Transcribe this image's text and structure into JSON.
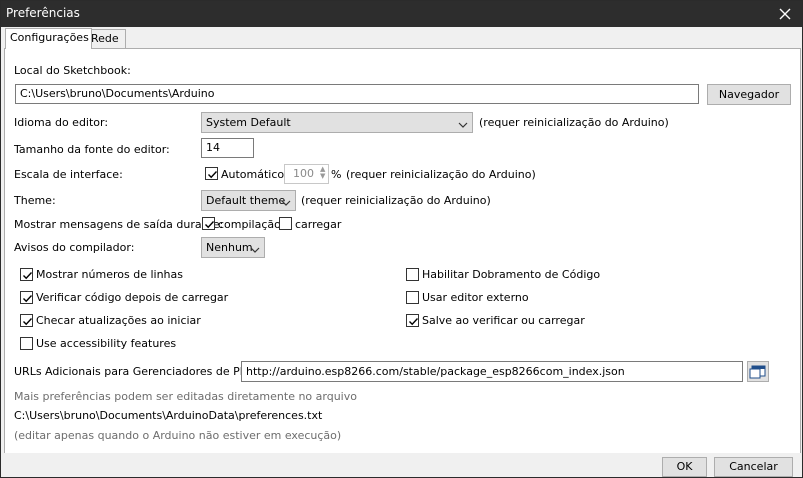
{
  "window": {
    "title": "Preferências"
  },
  "tabs": [
    {
      "label": "Configurações"
    },
    {
      "label": "Rede"
    }
  ],
  "sketchbook": {
    "label": "Local do Sketchbook:",
    "path": "C:\\Users\\bruno\\Documents\\Arduino",
    "browse_button": "Navegador"
  },
  "language": {
    "label": "Idioma do editor:",
    "value": "System Default",
    "note": "(requer reinicialização do Arduino)"
  },
  "font_size": {
    "label": "Tamanho da fonte do editor:",
    "value": "14"
  },
  "scale": {
    "label": "Escala de interface:",
    "auto_label": "Automático",
    "value": "100",
    "unit": "%",
    "note": "(requer reinicialização do Arduino)",
    "auto_checked": true
  },
  "theme": {
    "label": "Theme:",
    "value": "Default theme",
    "note": "(requer reinicialização do Arduino)"
  },
  "verbose": {
    "label": "Mostrar mensagens de saída durante:",
    "compile_label": "compilação",
    "compile_checked": true,
    "upload_label": "carregar",
    "upload_checked": false
  },
  "warnings": {
    "label": "Avisos do compilador:",
    "value": "Nenhum"
  },
  "options_left": [
    {
      "label": "Mostrar números de linhas",
      "checked": true
    },
    {
      "label": "Verificar código depois de carregar",
      "checked": true
    },
    {
      "label": "Checar atualizações ao iniciar",
      "checked": true
    },
    {
      "label": "Use accessibility features",
      "checked": false
    }
  ],
  "options_right": [
    {
      "label": "Habilitar Dobramento de Código",
      "checked": false
    },
    {
      "label": "Usar editor externo",
      "checked": false
    },
    {
      "label": "Salve ao verificar ou carregar",
      "checked": true
    }
  ],
  "boards_urls": {
    "label": "URLs Adicionais para Gerenciadores de Placas:",
    "value": "http://arduino.esp8266.com/stable/package_esp8266com_index.json"
  },
  "more_prefs": {
    "note": "Mais preferências podem ser editadas diretamente no arquivo",
    "path": "C:\\Users\\bruno\\Documents\\ArduinoData\\preferences.txt",
    "edit_note": "(editar apenas quando o Arduino não estiver em execução)"
  },
  "footer": {
    "ok": "OK",
    "cancel": "Cancelar"
  }
}
